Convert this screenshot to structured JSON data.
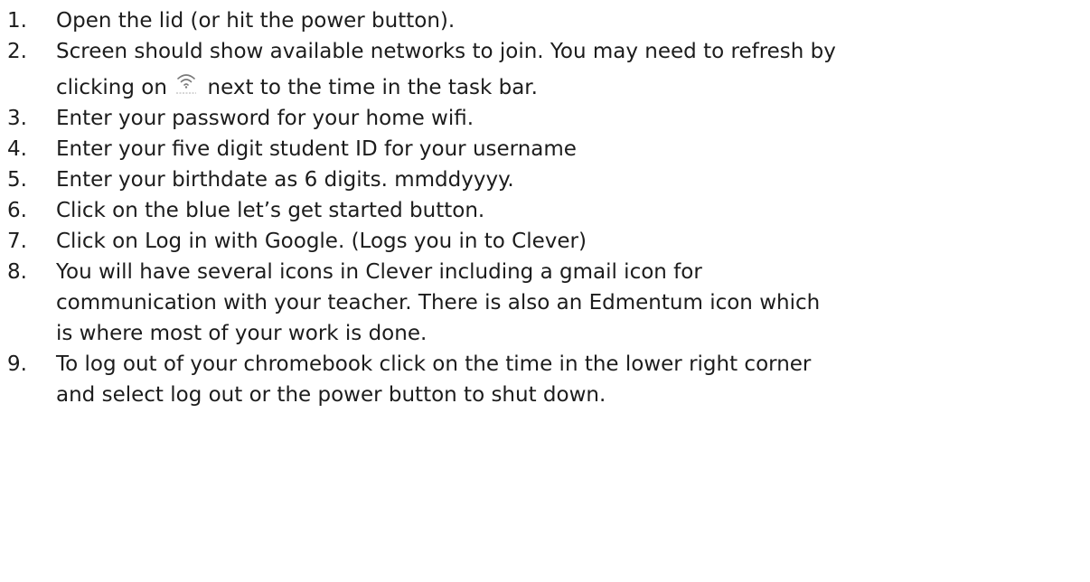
{
  "steps": [
    {
      "number": "1.",
      "lines": [
        "Open the lid (or hit the power button)."
      ]
    },
    {
      "number": "2.",
      "lines": [
        "Screen should show available networks to join. You may need to refresh by"
      ],
      "line2_before": "clicking on",
      "line2_after": "next to the time in the task bar.",
      "icon": "wifi-icon"
    },
    {
      "number": "3.",
      "lines": [
        "Enter your password for your home wifi."
      ]
    },
    {
      "number": "4.",
      "lines": [
        "Enter your five digit student ID for your username"
      ]
    },
    {
      "number": "5.",
      "lines": [
        "Enter your birthdate as 6 digits.  mmddyyyy."
      ]
    },
    {
      "number": "6.",
      "lines": [
        "Click on the blue let’s get started button."
      ]
    },
    {
      "number": "7.",
      "lines": [
        "Click on Log in with Google. (Logs you in to Clever)"
      ]
    },
    {
      "number": "8.",
      "lines": [
        "You will have several icons in Clever including a gmail icon for",
        "communication with your teacher.  There is also an Edmentum icon which",
        "is where most of your work is done."
      ]
    },
    {
      "number": "9.",
      "lines": [
        "To log out of your chromebook click on the time in the lower right corner",
        "and select log out or the power button to shut down."
      ]
    }
  ]
}
